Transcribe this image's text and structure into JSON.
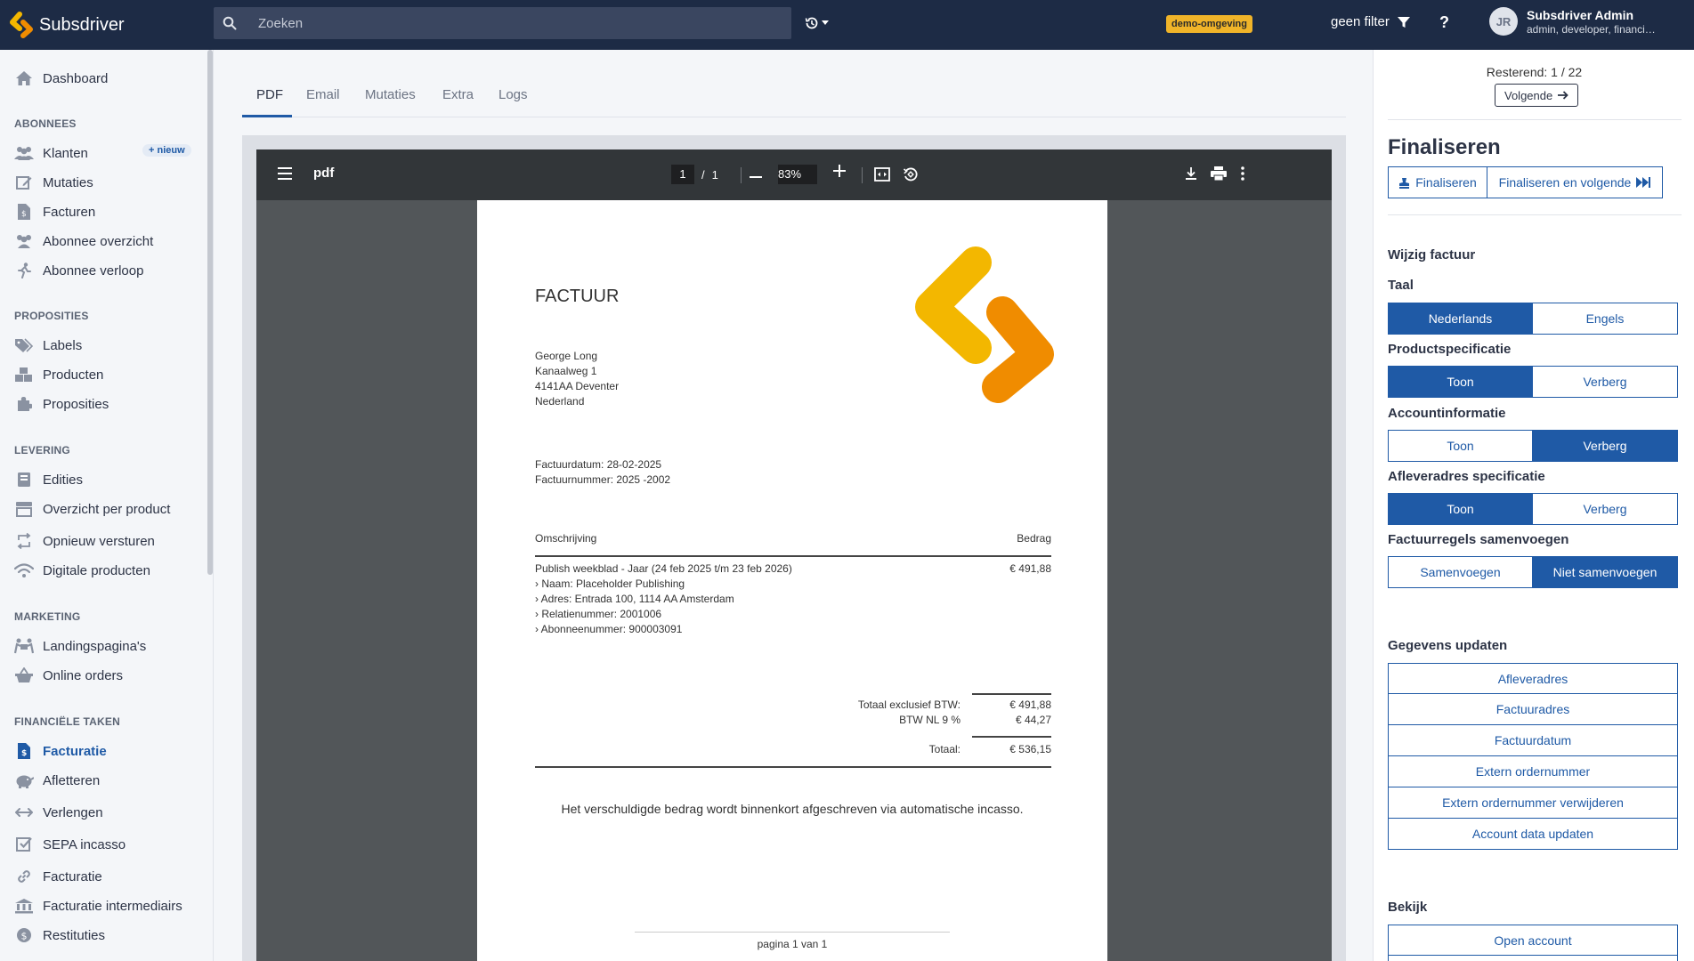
{
  "topbar": {
    "brand": "Subsdriver",
    "search_placeholder": "Zoeken",
    "env_badge": "demo-omgeving",
    "filter_label": "geen filter",
    "help": "?",
    "user": {
      "initials": "JR",
      "name": "Subsdriver Admin",
      "roles": "admin, developer, financial..."
    }
  },
  "sidebar": {
    "dashboard": "Dashboard",
    "sections": {
      "abonnees": "ABONNEES",
      "proposities": "PROPOSITIES",
      "levering": "LEVERING",
      "marketing": "MARKETING",
      "financiele_taken": "FINANCIËLE TAKEN"
    },
    "new_badge": "+ nieuw",
    "items": {
      "klanten": "Klanten",
      "mutaties": "Mutaties",
      "facturen": "Facturen",
      "abonnee_overzicht": "Abonnee overzicht",
      "abonnee_verloop": "Abonnee verloop",
      "labels": "Labels",
      "producten": "Producten",
      "proposities": "Proposities",
      "edities": "Edities",
      "overzicht_per_product": "Overzicht per product",
      "opnieuw_versturen": "Opnieuw versturen",
      "digitale_producten": "Digitale producten",
      "landingspaginas": "Landingspagina's",
      "online_orders": "Online orders",
      "facturatie": "Facturatie",
      "afletteren": "Afletteren",
      "verlengen": "Verlengen",
      "sepa_incasso": "SEPA incasso",
      "facturatie_link": "Facturatie",
      "facturatie_intermediairs": "Facturatie intermediairs",
      "restituties": "Restituties"
    }
  },
  "main": {
    "tabs": [
      "PDF",
      "Email",
      "Mutaties",
      "Extra",
      "Logs"
    ],
    "active_tab": "PDF"
  },
  "pdf_viewer": {
    "title": "pdf",
    "page_current": "1",
    "page_total": "1",
    "page_sep": "/",
    "zoom": "83%"
  },
  "invoice": {
    "title": "FACTUUR",
    "address": [
      "George Long",
      "Kanaalweg 1",
      "4141AA Deventer",
      "Nederland"
    ],
    "factuurdatum": "Factuurdatum: 28-02-2025",
    "factuurnummer": "Factuurnummer: 2025 -2002",
    "col_omschrijving": "Omschrijving",
    "col_bedrag": "Bedrag",
    "line_desc": "Publish weekblad - Jaar (24 feb 2025 t/m 23 feb 2026)",
    "line_amount": "€ 491,88",
    "line_details": [
      "› Naam: Placeholder Publishing",
      "› Adres: Entrada 100, 1114 AA Amsterdam",
      "› Relatienummer: 2001006",
      "› Abonneenummer: 900003091"
    ],
    "totaal_excl_label": "Totaal exclusief BTW:",
    "totaal_excl_value": "€ 491,88",
    "btw_label": "BTW NL 9 %",
    "btw_value": "€ 44,27",
    "totaal_label": "Totaal:",
    "totaal_value": "€ 536,15",
    "incasso_note": "Het verschuldigde bedrag wordt binnenkort afgeschreven via automatische incasso.",
    "footer": "pagina 1 van 1"
  },
  "right_panel": {
    "remaining": "Resterend: 1 / 22",
    "next_label": "Volgende",
    "finalize_title": "Finaliseren",
    "finalize_btn": "Finaliseren",
    "finalize_next_btn": "Finaliseren en volgende",
    "wijzig_title": "Wijzig factuur",
    "taal": {
      "label": "Taal",
      "options": [
        "Nederlands",
        "Engels"
      ],
      "selected": "Nederlands"
    },
    "productspecificatie": {
      "label": "Productspecificatie",
      "options": [
        "Toon",
        "Verberg"
      ],
      "selected": "Toon"
    },
    "accountinformatie": {
      "label": "Accountinformatie",
      "options": [
        "Toon",
        "Verberg"
      ],
      "selected": "Verberg"
    },
    "afleveradres": {
      "label": "Afleveradres specificatie",
      "options": [
        "Toon",
        "Verberg"
      ],
      "selected": "Toon"
    },
    "samenvoegen": {
      "label": "Factuurregels samenvoegen",
      "options": [
        "Samenvoegen",
        "Niet samenvoegen"
      ],
      "selected": "Niet samenvoegen"
    },
    "gegevens_title": "Gegevens updaten",
    "gegevens_buttons": [
      "Afleveradres",
      "Factuuradres",
      "Factuurdatum",
      "Extern ordernummer",
      "Extern ordernummer verwijderen",
      "Account data updaten"
    ],
    "bekijk_title": "Bekijk",
    "bekijk_buttons": [
      "Open account"
    ]
  },
  "colors": {
    "topbar": "#1d2b45",
    "primary": "#1f5aa6",
    "badge": "#f0b429",
    "logo_yellow": "#f3b700",
    "logo_orange": "#f08c00"
  }
}
